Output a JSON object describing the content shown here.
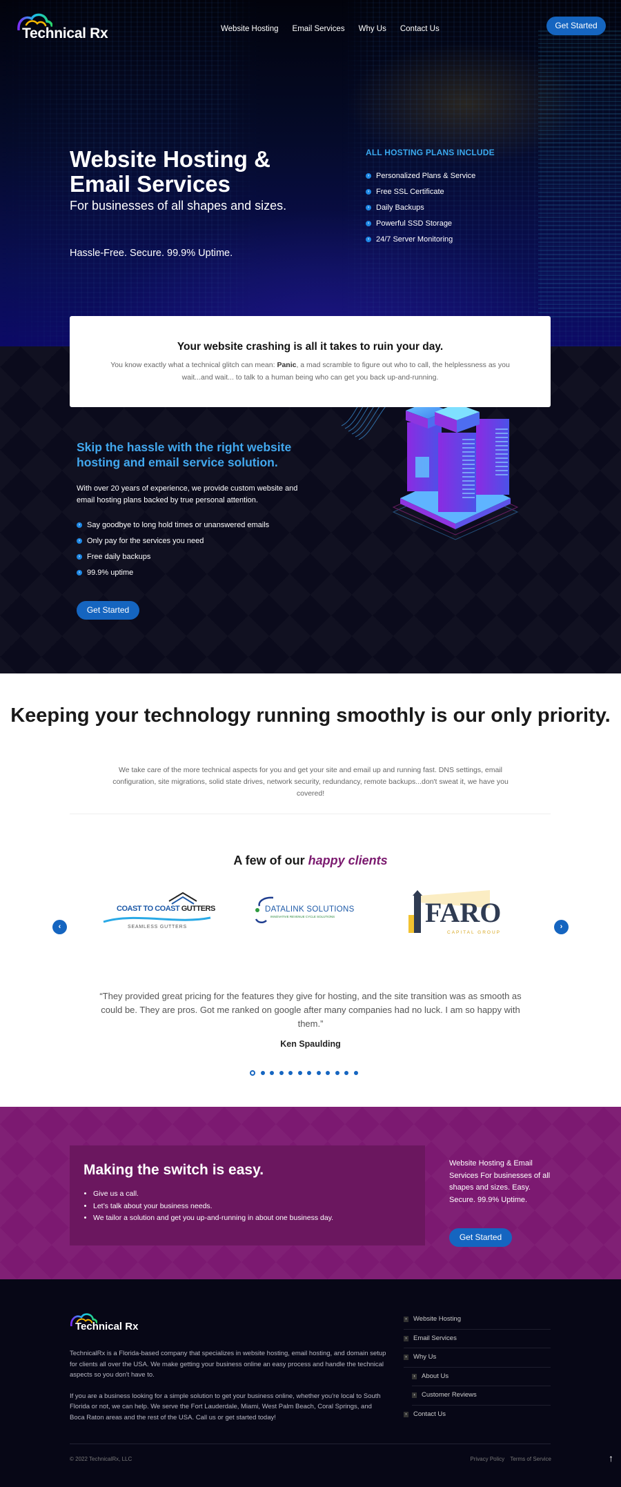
{
  "nav": {
    "logo_text": "Technical Rx",
    "links": [
      "Website Hosting",
      "Email Services",
      "Why Us",
      "Contact Us"
    ],
    "cta": "Get Started"
  },
  "hero": {
    "title": "Website Hosting & Email Services",
    "subtitle": "For businesses of all shapes and sizes.",
    "tagline": "Hassle-Free. Secure. 99.9% Uptime.",
    "plans_heading": "ALL HOSTING PLANS INCLUDE",
    "plans": [
      "Personalized Plans & Service",
      "Free SSL Certificate",
      "Daily Backups",
      "Powerful SSD Storage",
      "24/7 Server Monitoring"
    ]
  },
  "crash_card": {
    "title": "Your website crashing is all it takes to ruin your day.",
    "body_before": "You know exactly what a technical glitch can mean: ",
    "body_bold": "Panic",
    "body_after": ", a mad scramble to figure out who to call, the helplessness as you wait...and wait... to talk to a human being who can get you back up-and-running."
  },
  "skip": {
    "title": "Skip the hassle with the right website hosting and email service solution.",
    "description": "With over 20 years of experience, we provide custom website and email hosting plans backed by true personal attention.",
    "bullets": [
      "Say goodbye to long hold times or unanswered emails",
      "Only pay for the services you need",
      "Free daily backups",
      "99.9% uptime"
    ],
    "cta": "Get Started"
  },
  "priority": {
    "title": "Keeping your technology running smoothly is our only priority.",
    "body": "We take care of the more technical aspects for you and get your site and email up and running fast. DNS settings, email configuration, site migrations, solid state drives, network security, redundancy, remote backups...don't sweat it, we have you covered!"
  },
  "clients": {
    "heading_prefix": "A few of our ",
    "heading_highlight": "happy clients",
    "logos": [
      {
        "name": "COAST TO COAST GUTTERS",
        "name_a": "COAST TO COAST ",
        "name_b": "GUTTERS",
        "tagline": "SEAMLESS GUTTERS"
      },
      {
        "name": "DATALINK SOLUTIONS",
        "tagline": "INNOVATIVE REVENUE CYCLE SOLUTIONS"
      },
      {
        "name": "FARO",
        "tagline": "CAPITAL GROUP"
      }
    ],
    "prev_icon": "‹",
    "next_icon": "›",
    "testimonial": "“They provided great pricing for the features they give for hosting, and the site transition was as smooth as could be. They are pros. Got me ranked on google after many companies had no luck. I am so happy with them.”",
    "author": "Ken Spaulding",
    "slide_count": 12,
    "active_slide": 1
  },
  "switch": {
    "title": "Making the switch is easy.",
    "steps": [
      "Give us a call.",
      "Let’s talk about your business needs.",
      "We tailor a solution and get you up-and-running in about one business day."
    ],
    "side_text": "Website Hosting & Email Services For businesses of all shapes and sizes. Easy. Secure. 99.9% Uptime.",
    "cta": "Get Started"
  },
  "footer": {
    "logo_text": "Technical Rx",
    "about_1": "TechnicalRx is a Florida-based company that specializes in website hosting, email hosting, and domain setup for clients all over the USA.  We make getting your business online an easy process and handle the technical aspects so you don't have to.",
    "about_2": "If you are a business looking for a simple solution to get your business online, whether you're local to South Florida or not, we can help. We serve the Fort Lauderdale, Miami, West Palm Beach, Coral Springs, and Boca Raton areas and the rest of the USA. Call us or get started today!",
    "links": [
      {
        "label": "Website Hosting",
        "sub": false
      },
      {
        "label": "Email Services",
        "sub": false
      },
      {
        "label": "Why Us",
        "sub": false
      },
      {
        "label": "About Us",
        "sub": true
      },
      {
        "label": "Customer Reviews",
        "sub": true
      },
      {
        "label": "Contact Us",
        "sub": false
      }
    ],
    "copyright": "© 2022 TechnicalRx, LLC",
    "privacy": "Privacy Policy",
    "terms": "Terms of Service",
    "back_to_top_icon": "↑"
  },
  "colors": {
    "accent_blue": "#1565c0",
    "heading_blue": "#42a8ee",
    "purple": "#7c1971",
    "purple_dark": "#6b175f",
    "highlight_purple": "#7b1a6f"
  }
}
